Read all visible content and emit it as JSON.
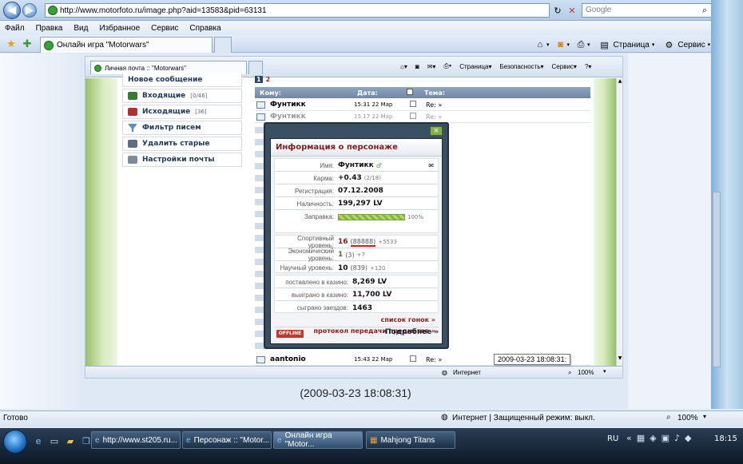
{
  "browser": {
    "url": "http://www.motorfoto.ru/image.php?aid=13583&pid=63131",
    "search_placeholder": "Google",
    "menu": [
      "Файл",
      "Правка",
      "Вид",
      "Избранное",
      "Сервис",
      "Справка"
    ],
    "tab_title": "Онлайн игра \"Motorwars\"",
    "toolbar": {
      "page": "Страница",
      "tools": "Сервис"
    }
  },
  "inner": {
    "tab_title": "Личная почта :: \"Motorwars\"",
    "toolbar": {
      "page": "Страница",
      "security": "Безопасность",
      "tools": "Сервис"
    },
    "sidebar": [
      {
        "label": "Новое сообщение",
        "count": ""
      },
      {
        "label": "Входящие",
        "count": "[0/46]"
      },
      {
        "label": "Исходящие",
        "count": "[36]"
      },
      {
        "label": "Фильтр писем",
        "count": ""
      },
      {
        "label": "Удалить старые",
        "count": ""
      },
      {
        "label": "Настройки почты",
        "count": ""
      }
    ],
    "pages": [
      "1",
      "2"
    ],
    "table_headers": {
      "to": "Кому:",
      "date": "Дата:",
      "subject": "Тема:"
    },
    "rows": [
      {
        "to": "Фунтикк",
        "date": "15:31 22 Мар",
        "subject": "Re: »"
      },
      {
        "to": "Фунтикк",
        "date": "15:17 22 Мар",
        "subject": "Re: »"
      },
      {
        "to": "aantonio",
        "date": "15:43 22 Мар",
        "subject": "Re: »"
      }
    ],
    "status_internet": "Интернет",
    "status_zoom": "100%",
    "tooltip": "2009-03-23 18:08:31:"
  },
  "popup": {
    "title": "Информация о персонаже",
    "name_label": "Имя:",
    "name": "Фунтикк",
    "karma_label": "Карма:",
    "karma": "+0.43",
    "karma_small": "(2/18)",
    "reg_label": "Регистрация:",
    "reg": "07.12.2008",
    "cash_label": "Наличность:",
    "cash": "199,297 LV",
    "fuel_label": "Заправка:",
    "fuel_pct": "100%",
    "fuel_fraction": 1.0,
    "sport_label": "Спортивный уровень:",
    "sport": "16",
    "sport_pts": "(88888)",
    "sport_small": "+5533",
    "econ_label": "Экономический уровень:",
    "econ": "1",
    "econ_pts": "(3)",
    "econ_small": "+7",
    "sci_label": "Научный уровень:",
    "sci": "10",
    "sci_pts": "(839)",
    "sci_small": "+120",
    "casino_bet_label": "поставлено в казино:",
    "casino_bet": "8,269 LV",
    "casino_win_label": "выиграно в казино:",
    "casino_win": "11,700 LV",
    "races_label": "сыграно заездов:",
    "races": "1463",
    "link_races": "список гонок »",
    "link_items": "протокол передачи предметов »",
    "offline": "OFFLINE",
    "more": "Подробнее »"
  },
  "caption": "(2009-03-23 18:08:31)",
  "status": {
    "left": "Готово",
    "zone": "Интернет | Защищенный режим: выкл.",
    "zoom": "100%"
  },
  "taskbar": {
    "tasks": [
      "http://www.st205.ru...",
      "Персонаж :: \"Motor...",
      "Онлайн игра \"Motor...",
      "Mahjong Titans"
    ],
    "lang": "RU",
    "clock": "18:15"
  }
}
